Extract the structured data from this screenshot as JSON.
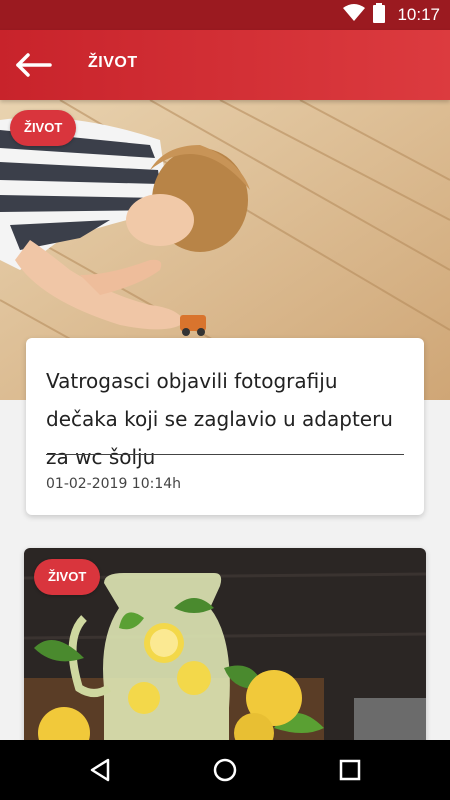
{
  "status_bar": {
    "time": "10:17",
    "icons": [
      "wifi-icon",
      "battery-icon"
    ]
  },
  "app_bar": {
    "back_icon": "arrow-left-icon",
    "title": "ŽIVOT"
  },
  "articles": [
    {
      "category": "ŽIVOT",
      "title": "Vatrogasci objavili fotografiju dečaka koji se zaglavio u adapteru za wc šolju",
      "date": "01-02-2019 10:14h"
    },
    {
      "category": "ŽIVOT"
    }
  ],
  "nav_bar": {
    "icons": [
      "back-triangle-icon",
      "home-circle-icon",
      "recents-square-icon"
    ]
  },
  "colors": {
    "primary": "#c8232b",
    "status_bar": "#9b1a20",
    "badge": "#d9353d"
  }
}
